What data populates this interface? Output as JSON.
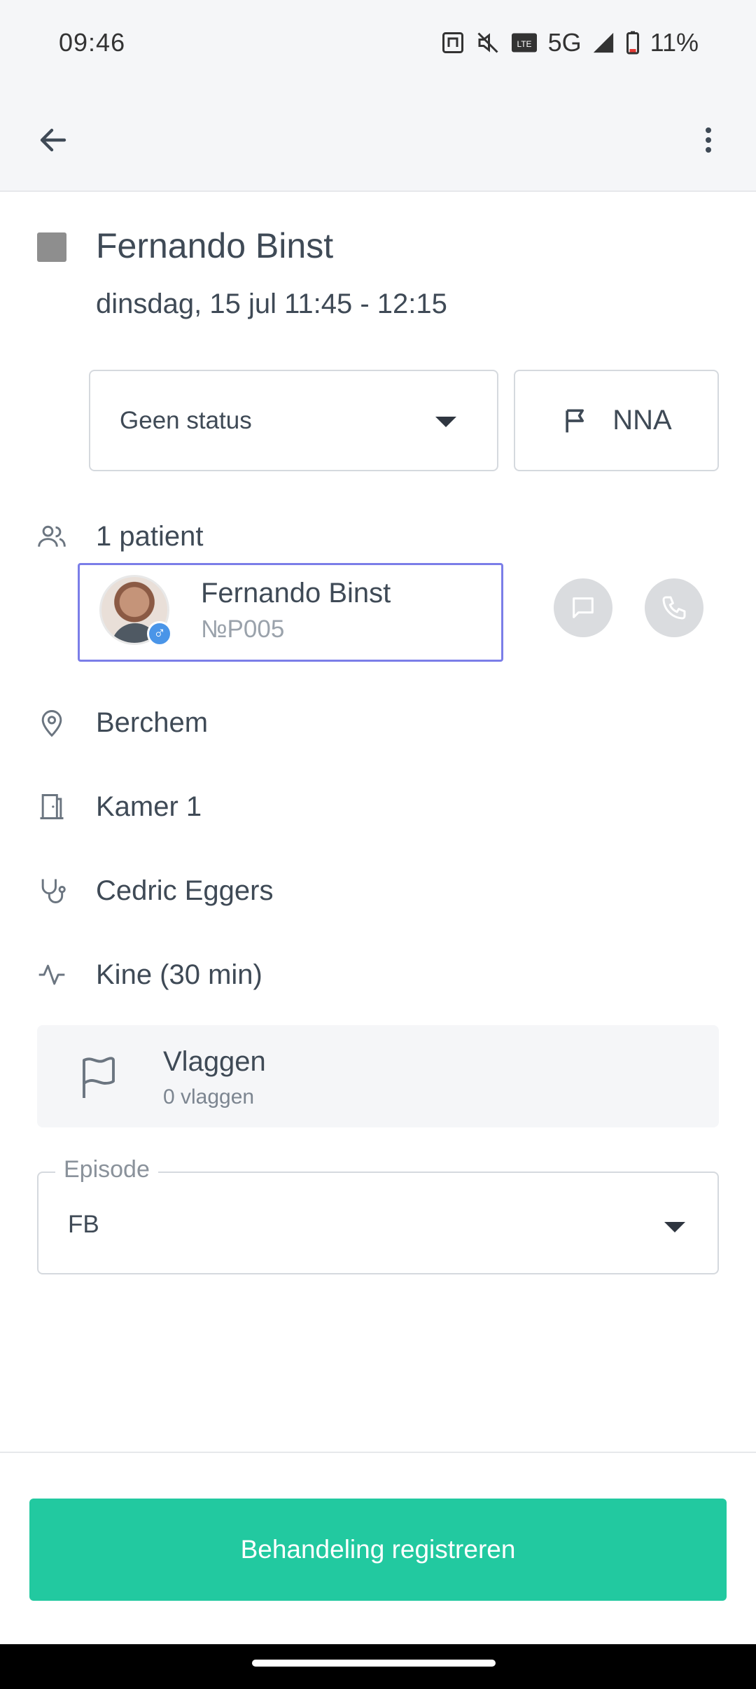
{
  "status_bar": {
    "time": "09:46",
    "network": "5G",
    "battery": "11%",
    "icons": [
      "nfc-icon",
      "mute-icon",
      "volte-icon",
      "signal-icon",
      "battery-icon"
    ]
  },
  "app_bar": {
    "back_icon": "arrow-left-icon",
    "more_icon": "more-vertical-icon"
  },
  "appointment": {
    "title": "Fernando Binst",
    "datetime": "dinsdag, 15 jul 11:45 - 12:15",
    "color": "#8e8e8e"
  },
  "status": {
    "selected": "Geen status",
    "flag_label": "NNA"
  },
  "patients": {
    "count_label": "1 patient",
    "items": [
      {
        "name": "Fernando Binst",
        "id": "№P005",
        "gender_symbol": "♂"
      }
    ]
  },
  "details": {
    "location": "Berchem",
    "room": "Kamer 1",
    "practitioner": "Cedric Eggers",
    "service": "Kine (30 min)"
  },
  "flags": {
    "title": "Vlaggen",
    "count": "0 vlaggen"
  },
  "episode": {
    "label": "Episode",
    "value": "FB"
  },
  "actions": {
    "primary_label": "Behandeling registreren"
  },
  "colors": {
    "accent": "#22c9a0",
    "selection_border": "#7b7ee8",
    "text": "#3f4a56"
  }
}
